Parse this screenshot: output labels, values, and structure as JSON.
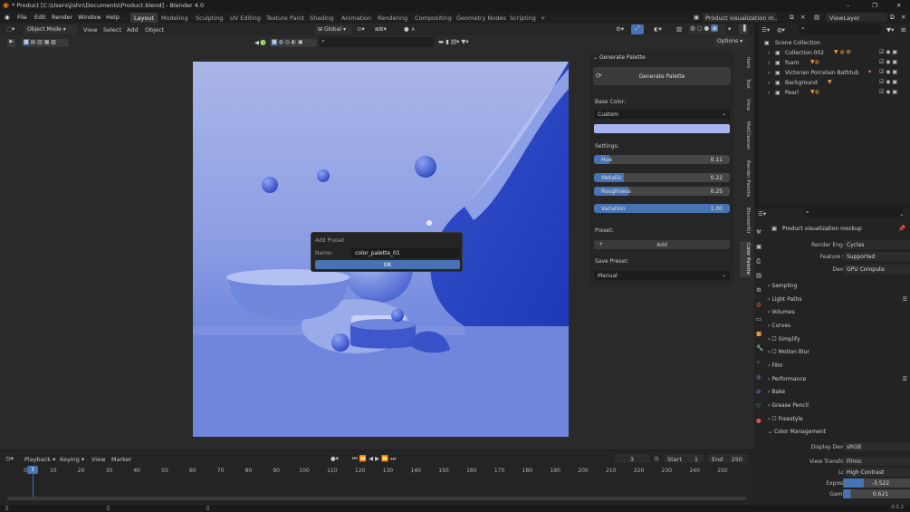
{
  "title": "* Product [C:\\Users\\jishn\\Documents\\Product.blend] - Blender 4.0",
  "window_controls": [
    "–",
    "❐",
    "✕"
  ],
  "menu": [
    "File",
    "Edit",
    "Render",
    "Window",
    "Help"
  ],
  "workspaces": [
    "Layout",
    "Modeling",
    "Sculpting",
    "UV Editing",
    "Texture Paint",
    "Shading",
    "Animation",
    "Rendering",
    "Compositing",
    "Geometry Nodes",
    "Scripting",
    "+"
  ],
  "active_workspace": "Layout",
  "scene_name": "Product visualization m...",
  "view_layer": "ViewLayer",
  "viewport_header": {
    "mode": "Object Mode",
    "menus": [
      "View",
      "Select",
      "Add",
      "Object"
    ],
    "transform": "Global",
    "options": "Options"
  },
  "dialog": {
    "title": "Add Preset",
    "name_label": "Name:",
    "name_value": "color_palette_01",
    "ok": "OK"
  },
  "npanel": {
    "header": "Generate Palette",
    "generate_button": "Generate Palette",
    "base_color_label": "Base Color:",
    "base_color_value": "Custom",
    "swatch_color": "#a7b4ef",
    "settings_label": "Settings:",
    "sliders": [
      {
        "label": "Hue",
        "value": "0.11",
        "fraction": 0.11
      },
      {
        "label": "Metallic",
        "value": "0.22",
        "fraction": 0.22
      },
      {
        "label": "Roughness",
        "value": "0.25",
        "fraction": 0.25
      },
      {
        "label": "Variation",
        "value": "1.00",
        "fraction": 1.0
      }
    ],
    "preset_label": "Preset:",
    "add_label": "Add",
    "save_preset_label": "Save Preset:",
    "save_preset_value": "Manual"
  },
  "side_tabs": [
    "Item",
    "Tool",
    "View",
    "MatCleaner",
    "Render Palette",
    "BlenderKit",
    "Color Palette"
  ],
  "outliner": {
    "root": "Scene Collection",
    "items": [
      "Collection.002",
      "foam",
      "Victorian Porcelain Bathtub",
      "Background",
      "Pearl"
    ]
  },
  "properties": {
    "scene_title": "Product visualization mockup",
    "render_engine_label": "Render Engine",
    "render_engine": "Cycles",
    "feature_set_label": "Feature Set",
    "feature_set": "Supported",
    "device_label": "Device",
    "device": "GPU Compute",
    "sections": [
      "Sampling",
      "Light Paths",
      "Volumes",
      "Curves",
      "Simplify",
      "Motion Blur",
      "Film",
      "Performance",
      "Bake",
      "Grease Pencil",
      "Freestyle",
      "Color Management"
    ],
    "display_device_label": "Display Device",
    "display_device": "sRGB",
    "view_transform_label": "View Transform",
    "view_transform": "Filmic",
    "look_label": "Look",
    "look": "High Contrast",
    "exposure_label": "Exposure",
    "exposure": "-3.522",
    "gamma_label": "Gamma",
    "gamma": "0.621"
  },
  "timeline": {
    "menus": [
      "Playback",
      "Keying",
      "View",
      "Marker"
    ],
    "current_frame": "3",
    "start_label": "Start",
    "start": "1",
    "end_label": "End",
    "end": "250",
    "ticks": [
      "0",
      "10",
      "20",
      "30",
      "40",
      "50",
      "60",
      "70",
      "80",
      "90",
      "100",
      "110",
      "120",
      "130",
      "140",
      "150",
      "160",
      "170",
      "180",
      "190",
      "200",
      "210",
      "220",
      "230",
      "240",
      "250"
    ]
  },
  "version": "4.0.2",
  "accent": "#4772b3"
}
